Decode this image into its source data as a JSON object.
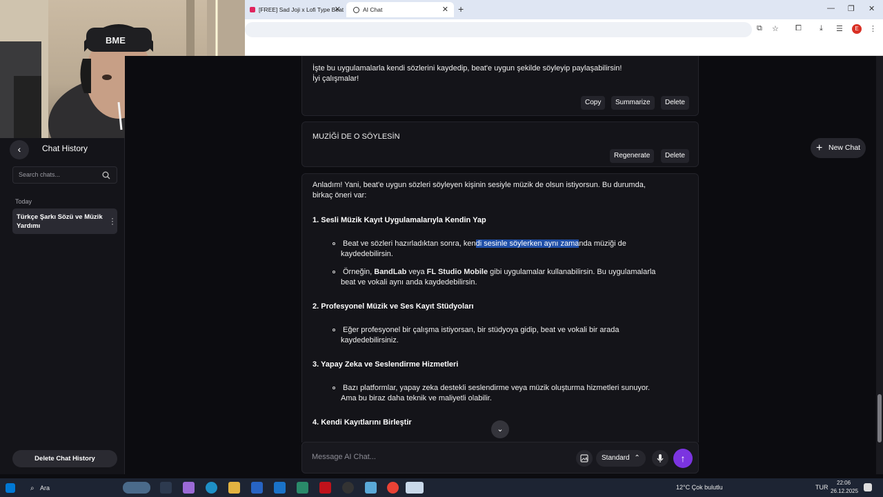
{
  "browser": {
    "tabs": [
      {
        "label": "[FREE] Sad Joji x Lofi Type Beat"
      },
      {
        "label": "AI Chat"
      }
    ]
  },
  "sidebar": {
    "title": "Chat History",
    "search_placeholder": "Search chats...",
    "group_label": "Today",
    "items": [
      {
        "label": "Türkçe Şarkı Sözü ve Müzik Yardımı"
      }
    ],
    "delete_history_label": "Delete Chat History"
  },
  "header": {
    "new_chat_label": "New Chat"
  },
  "messages": {
    "prev_assistant": {
      "line1": "İşte bu uygulamalarla kendi sözlerini kaydedip, beat'e uygun şekilde söyleyip paylaşabilirsin!",
      "line2": "İyi çalışmalar!",
      "copy_label": "Copy",
      "summarize_label": "Summarize",
      "delete_label": "Delete"
    },
    "user": {
      "text": "MUZİĞİ DE O SÖYLESİN",
      "regenerate_label": "Regenerate",
      "delete_label": "Delete"
    },
    "assistant": {
      "intro_line1": "Anladım! Yani, beat'e uygun sözleri söyleyen kişinin sesiyle müzik de olsun istiyorsun. Bu durumda,",
      "intro_line2": "birkaç öneri var:",
      "s1_title": "1. Sesli Müzik Kayıt Uygulamalarıyla Kendin Yap",
      "s1_b1_pre": "Beat ve sözleri hazırladıktan sonra, ken",
      "s1_b1_hl": "di sesinle söylerken aynı zama",
      "s1_b1_post": "nda müziği de",
      "s1_b1_line2": "kaydedebilirsin.",
      "s1_b2_pre": "Örneğin, ",
      "s1_b2_bold1": "BandLab",
      "s1_b2_mid": " veya ",
      "s1_b2_bold2": "FL Studio Mobile",
      "s1_b2_post": " gibi uygulamalar kullanabilirsin. Bu uygulamalarla",
      "s1_b2_line2": "beat ve vokali aynı anda kaydedebilirsin.",
      "s2_title": "2. Profesyonel Müzik ve Ses Kayıt Stüdyoları",
      "s2_b1_line1": "Eğer profesyonel bir çalışma istiyorsan, bir stüdyoya gidip, beat ve vokali bir arada",
      "s2_b1_line2": "kaydedebilirsiniz.",
      "s3_title": "3. Yapay Zeka ve Seslendirme Hizmetleri",
      "s3_b1_line1": "Bazı platformlar, yapay zeka destekli seslendirme veya müzik oluşturma hizmetleri sunuyor.",
      "s3_b1_line2": "Ama bu biraz daha teknik ve maliyetli olabilir.",
      "s4_title": "4. Kendi Kayıtlarını Birleştir"
    }
  },
  "composer": {
    "placeholder": "Message AI Chat...",
    "mode_label": "Standard"
  },
  "taskbar": {
    "search_label": "Ara",
    "weather": "12°C  Çok bulutlu",
    "lang": "TUR",
    "time": "22:06",
    "date": "26.12.2025"
  },
  "colors": {
    "accent": "#7b34e0",
    "highlight": "#1f4fa8",
    "background": "#0c0c10",
    "card": "#141419"
  }
}
